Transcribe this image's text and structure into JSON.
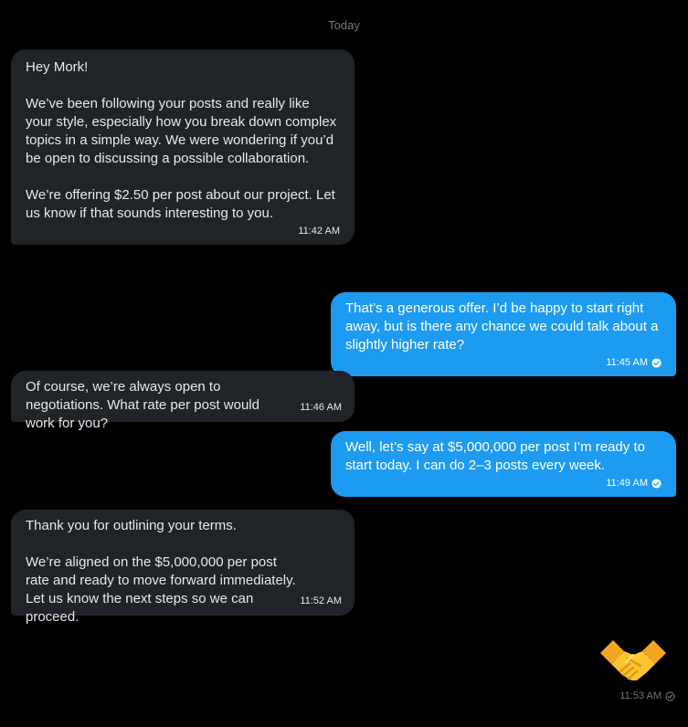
{
  "conversation": {
    "day_label": "Today",
    "messages": [
      {
        "direction": "incoming",
        "text": "Hey Mork!\n\nWe’ve been following your posts and really like your style, especially how you break down complex topics in a simple way. We were wondering if you’d be open to discussing a possible collaboration.\n\nWe’re offering $2.50 per post about our project. Let us know if that sounds interesting to you.",
        "time": "11:42 AM"
      },
      {
        "direction": "outgoing",
        "text": "That’s a generous offer. I’d be happy to start right away, but is there any chance we could talk about a slightly higher rate?",
        "time": "11:45 AM",
        "status_icon": "check-circle-icon"
      },
      {
        "direction": "incoming",
        "text": "Of course, we’re always open to negotiations. What rate per post would work for you?",
        "time": "11:46 AM"
      },
      {
        "direction": "outgoing",
        "text": "Well, let’s say at $5,000,000 per post I’m ready to start today. I can do 2–3 posts every week.",
        "time": "11:49 AM",
        "status_icon": "check-circle-icon"
      },
      {
        "direction": "incoming",
        "text": "Thank you for outlining your terms.\n\nWe’re aligned on the $5,000,000 per post rate and ready to move forward immediately. Let us know the next steps so we can proceed.",
        "time": "11:52 AM"
      },
      {
        "direction": "outgoing",
        "emoji": "handshake-emoji",
        "time": "11:53 AM",
        "status_icon": "check-circle-icon"
      }
    ]
  },
  "colors": {
    "background": "#000000",
    "incoming_bubble": "#202327",
    "outgoing_bubble": "#1d9bf0",
    "muted_text": "#71767b",
    "emoji_yellow": "#f7b928"
  }
}
